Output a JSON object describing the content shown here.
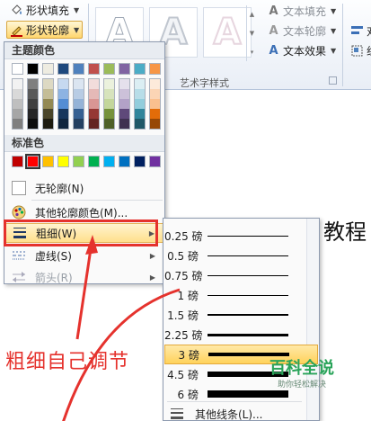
{
  "ribbon": {
    "shape_fill_label": "形状填充",
    "shape_outline_label": "形状轮廓",
    "text_fill_label": "文本填充",
    "text_outline_label": "文本轮廓",
    "text_effect_label": "文本效果",
    "wordart_styles_label": "艺术字样式",
    "wordart_letter": "A",
    "right_edge_items": [
      "对",
      "组"
    ]
  },
  "outline_menu": {
    "theme_colors_header": "主题颜色",
    "standard_colors_header": "标准色",
    "no_outline_label": "无轮廓(N)",
    "more_colors_label": "其他轮廓颜色(M)...",
    "weight_label": "粗细(W)",
    "dashes_label": "虚线(S)",
    "arrows_label": "箭头(R)",
    "theme_top_row": [
      "#ffffff",
      "#000000",
      "#eeece1",
      "#1f497d",
      "#4f81bd",
      "#c0504d",
      "#9bbb59",
      "#8064a2",
      "#4bacc6",
      "#f79646"
    ],
    "theme_shades": [
      [
        "#f2f2f2",
        "#d9d9d9",
        "#bfbfbf",
        "#a6a6a6",
        "#7f7f7f"
      ],
      [
        "#7f7f7f",
        "#595959",
        "#404040",
        "#262626",
        "#0d0d0d"
      ],
      [
        "#ddd9c3",
        "#c4bd97",
        "#938953",
        "#4a452a",
        "#1d1b10"
      ],
      [
        "#c6d9f0",
        "#8db3e2",
        "#548dd4",
        "#17365d",
        "#0f243e"
      ],
      [
        "#dbe5f1",
        "#b8cce4",
        "#95b3d7",
        "#366092",
        "#244061"
      ],
      [
        "#f2dcdb",
        "#e5b9b7",
        "#d99694",
        "#953734",
        "#632423"
      ],
      [
        "#ebf1dd",
        "#d7e3bc",
        "#c3d69b",
        "#76923c",
        "#4f6128"
      ],
      [
        "#e5e0ec",
        "#ccc1d9",
        "#b2a2c7",
        "#5f497a",
        "#3f3151"
      ],
      [
        "#dbeef3",
        "#b7dde8",
        "#92cddc",
        "#31859b",
        "#205867"
      ],
      [
        "#fdeada",
        "#fbd5b5",
        "#fac08f",
        "#e36c09",
        "#974806"
      ]
    ],
    "standard_colors": [
      "#c00000",
      "#ff0000",
      "#ffc000",
      "#ffff00",
      "#92d050",
      "#00b050",
      "#00b0f0",
      "#0070c0",
      "#002060",
      "#7030a0"
    ]
  },
  "weight_submenu": {
    "items": [
      {
        "label": "0.25 磅",
        "pt": 0.25
      },
      {
        "label": "0.5 磅",
        "pt": 0.5
      },
      {
        "label": "0.75 磅",
        "pt": 0.75
      },
      {
        "label": "1 磅",
        "pt": 1
      },
      {
        "label": "1.5 磅",
        "pt": 1.5
      },
      {
        "label": "2.25 磅",
        "pt": 2.25
      },
      {
        "label": "3 磅",
        "pt": 3
      },
      {
        "label": "4.5 磅",
        "pt": 4.5
      },
      {
        "label": "6 磅",
        "pt": 6
      }
    ],
    "selected_index": 6,
    "more_lines_label": "其他线条(L)..."
  },
  "annotation": {
    "text": "粗细自己调节",
    "color": "#e5322d"
  },
  "document": {
    "visible_text": "教程"
  },
  "watermark": {
    "title": "百科全说",
    "subtitle": "助你轻松解决"
  }
}
